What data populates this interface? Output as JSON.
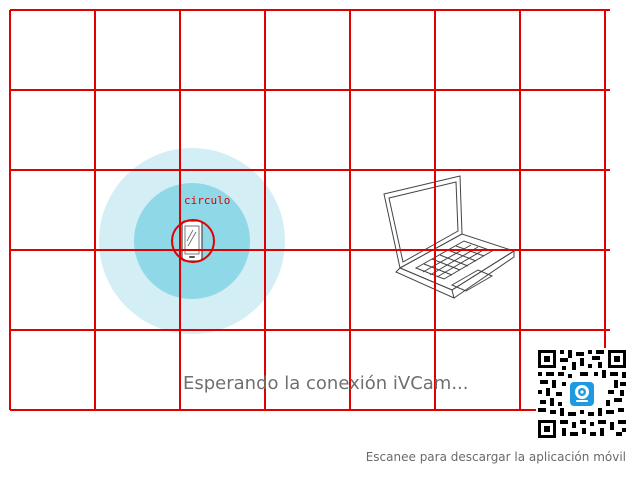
{
  "status": {
    "waiting_text": "Esperando la conexión iVCam..."
  },
  "qr": {
    "caption": "Escanee para descargar la aplicación móvil",
    "icon": "webcam-app-icon"
  },
  "annotation": {
    "label": "circulo",
    "color": "#e00000"
  },
  "grid_overlay": {
    "color": "#e00000",
    "columns": 7,
    "rows": 5
  },
  "colors": {
    "outer_ring": "#d3eef4",
    "inner_ring": "#8fd8e8",
    "device_stroke": "#444444",
    "accent": "#1e9be0"
  },
  "icons": [
    "phone-icon",
    "laptop-icon",
    "qr-code-icon"
  ]
}
